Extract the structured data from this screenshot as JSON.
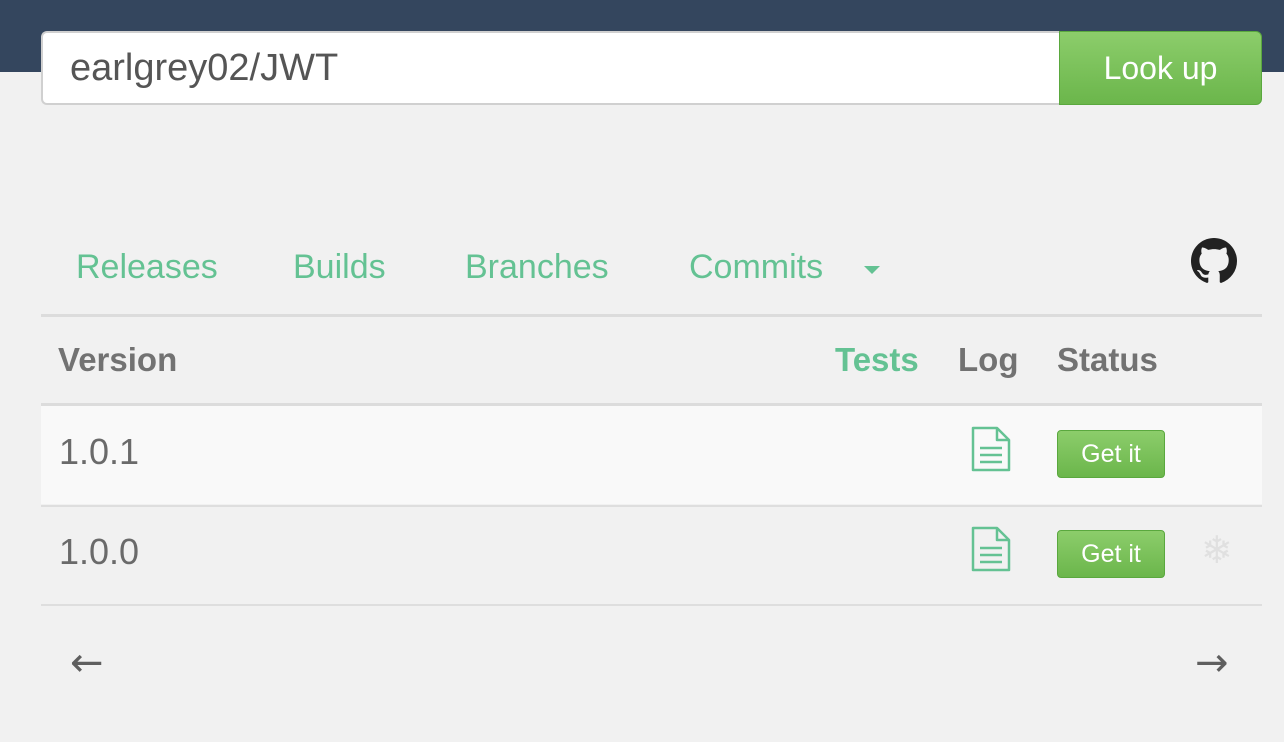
{
  "search": {
    "value": "earlgrey02/JWT",
    "button_label": "Look up"
  },
  "nav": {
    "tabs": [
      "Releases",
      "Builds",
      "Branches",
      "Commits"
    ]
  },
  "table": {
    "headers": {
      "version": "Version",
      "tests": "Tests",
      "log": "Log",
      "status": "Status"
    },
    "rows": [
      {
        "version": "1.0.1",
        "status_label": "Get it",
        "snapshot_icon": false
      },
      {
        "version": "1.0.0",
        "status_label": "Get it",
        "snapshot_icon": true
      }
    ]
  },
  "pagination": {
    "prev": "←",
    "next": "→"
  },
  "colors": {
    "topbar": "#34465e",
    "accent": "#64c293",
    "button_green": "#6bb64b"
  },
  "icons": [
    "github-icon",
    "caret-down-icon",
    "log-file-icon",
    "snowflake-icon"
  ]
}
